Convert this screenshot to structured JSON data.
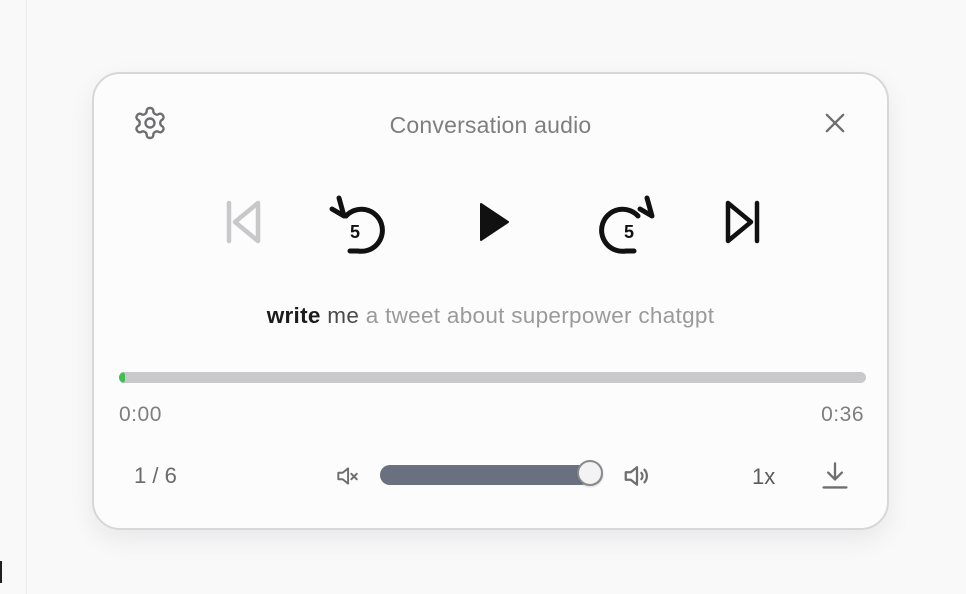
{
  "player": {
    "title": "Conversation audio",
    "transcript": {
      "spoken": "write",
      "current": "me",
      "remaining": "a tweet about superpower chatgpt"
    },
    "controls": {
      "rewind_seconds": "5",
      "forward_seconds": "5"
    },
    "progress": {
      "fraction": 0.006
    },
    "time": {
      "current": "0:00",
      "total": "0:36"
    },
    "counter": "1 / 6",
    "volume": {
      "fraction": 0.94
    },
    "speed": "1x"
  },
  "colors": {
    "progress_fill": "#3fbf52",
    "volume_fill": "#6b7080",
    "disabled_icon": "#c8c8ca",
    "active_icon": "#111111"
  },
  "icons": {
    "settings": "gear-icon",
    "close": "close-icon",
    "previous": "skip-previous-icon",
    "rewind": "rewind-5-icon",
    "play": "play-icon",
    "forward": "forward-5-icon",
    "next": "skip-next-icon",
    "mute": "volume-mute-icon",
    "volume": "volume-up-icon",
    "download": "download-icon"
  }
}
